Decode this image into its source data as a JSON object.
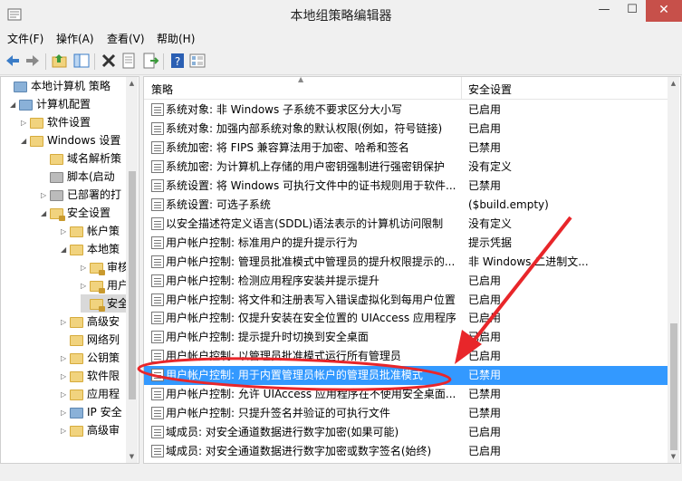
{
  "window": {
    "title": "本地组策略编辑器",
    "min_glyph": "—",
    "max_glyph": "☐",
    "close_glyph": "✕"
  },
  "menu": [
    "文件(F)",
    "操作(A)",
    "查看(V)",
    "帮助(H)"
  ],
  "toolbar": [
    "back-icon",
    "forward-icon",
    "up-folder-icon",
    "show-hide-tree-icon",
    "delete-icon",
    "properties-icon",
    "export-list-icon",
    "help-icon",
    "view-icon"
  ],
  "tree": [
    {
      "label": "本地计算机 策略",
      "arrow": "",
      "icon": "pc"
    },
    {
      "label": "计算机配置",
      "arrow": "◢",
      "icon": "pc"
    },
    {
      "label": "软件设置",
      "arrow": "▷",
      "icon": "folder"
    },
    {
      "label": "Windows 设置",
      "arrow": "◢",
      "icon": "folder"
    },
    {
      "label": "域名解析策",
      "arrow": "",
      "icon": "folder"
    },
    {
      "label": "脚本(启动",
      "arrow": "",
      "icon": "grey"
    },
    {
      "label": "已部署的打",
      "arrow": "▷",
      "icon": "grey"
    },
    {
      "label": "安全设置",
      "arrow": "◢",
      "icon": "lock"
    },
    {
      "label": "帐户策",
      "arrow": "▷",
      "icon": "folder"
    },
    {
      "label": "本地策",
      "arrow": "◢",
      "icon": "folder"
    },
    {
      "label": "审核",
      "arrow": "▷",
      "icon": "lock"
    },
    {
      "label": "用户",
      "arrow": "▷",
      "icon": "lock"
    },
    {
      "label": "安全",
      "arrow": "",
      "icon": "lock"
    },
    {
      "label": "高级安",
      "arrow": "▷",
      "icon": "folder"
    },
    {
      "label": "网络列",
      "arrow": "",
      "icon": "folder"
    },
    {
      "label": "公钥策",
      "arrow": "▷",
      "icon": "folder"
    },
    {
      "label": "软件限",
      "arrow": "▷",
      "icon": "folder"
    },
    {
      "label": "应用程",
      "arrow": "▷",
      "icon": "folder"
    },
    {
      "label": "IP 安全",
      "arrow": "▷",
      "icon": "pc"
    },
    {
      "label": "高级审",
      "arrow": "▷",
      "icon": "folder"
    }
  ],
  "list": {
    "columns": [
      "策略",
      "安全设置"
    ],
    "rows": [
      {
        "name": "系统对象: 非 Windows 子系统不要求区分大小写",
        "value": "已启用"
      },
      {
        "name": "系统对象: 加强内部系统对象的默认权限(例如，符号链接)",
        "value": "已启用"
      },
      {
        "name": "系统加密: 将 FIPS 兼容算法用于加密、哈希和签名",
        "value": "已禁用"
      },
      {
        "name": "系统加密: 为计算机上存储的用户密钥强制进行强密钥保护",
        "value": "没有定义"
      },
      {
        "name": "系统设置: 将 Windows 可执行文件中的证书规则用于软件...",
        "value": "已禁用"
      },
      {
        "name": "系统设置: 可选子系统",
        "value": "($build.empty)"
      },
      {
        "name": "以安全描述符定义语言(SDDL)语法表示的计算机访问限制",
        "value": "没有定义"
      },
      {
        "name": "用户帐户控制: 标准用户的提升提示行为",
        "value": "提示凭据"
      },
      {
        "name": "用户帐户控制: 管理员批准模式中管理员的提升权限提示的...",
        "value": "非 Windows 二进制文..."
      },
      {
        "name": "用户帐户控制: 检测应用程序安装并提示提升",
        "value": "已启用"
      },
      {
        "name": "用户帐户控制: 将文件和注册表写入错误虚拟化到每用户位置",
        "value": "已启用"
      },
      {
        "name": "用户帐户控制: 仅提升安装在安全位置的 UIAccess 应用程序",
        "value": "已启用"
      },
      {
        "name": "用户帐户控制: 提示提升时切换到安全桌面",
        "value": "已启用"
      },
      {
        "name": "用户帐户控制: 以管理员批准模式运行所有管理员",
        "value": "已启用"
      },
      {
        "name": "用户帐户控制: 用于内置管理员帐户的管理员批准模式",
        "value": "已禁用"
      },
      {
        "name": "用户帐户控制: 允许 UIAccess 应用程序在不使用安全桌面...",
        "value": "已禁用"
      },
      {
        "name": "用户帐户控制: 只提升签名并验证的可执行文件",
        "value": "已禁用"
      },
      {
        "name": "域成员: 对安全通道数据进行数字加密(如果可能)",
        "value": "已启用"
      },
      {
        "name": "域成员: 对安全通道数据进行数字加密或数字签名(始终)",
        "value": "已启用"
      }
    ],
    "selected_index": 14
  },
  "colors": {
    "selection": "#3399ff",
    "annotation": "#e8262a"
  }
}
